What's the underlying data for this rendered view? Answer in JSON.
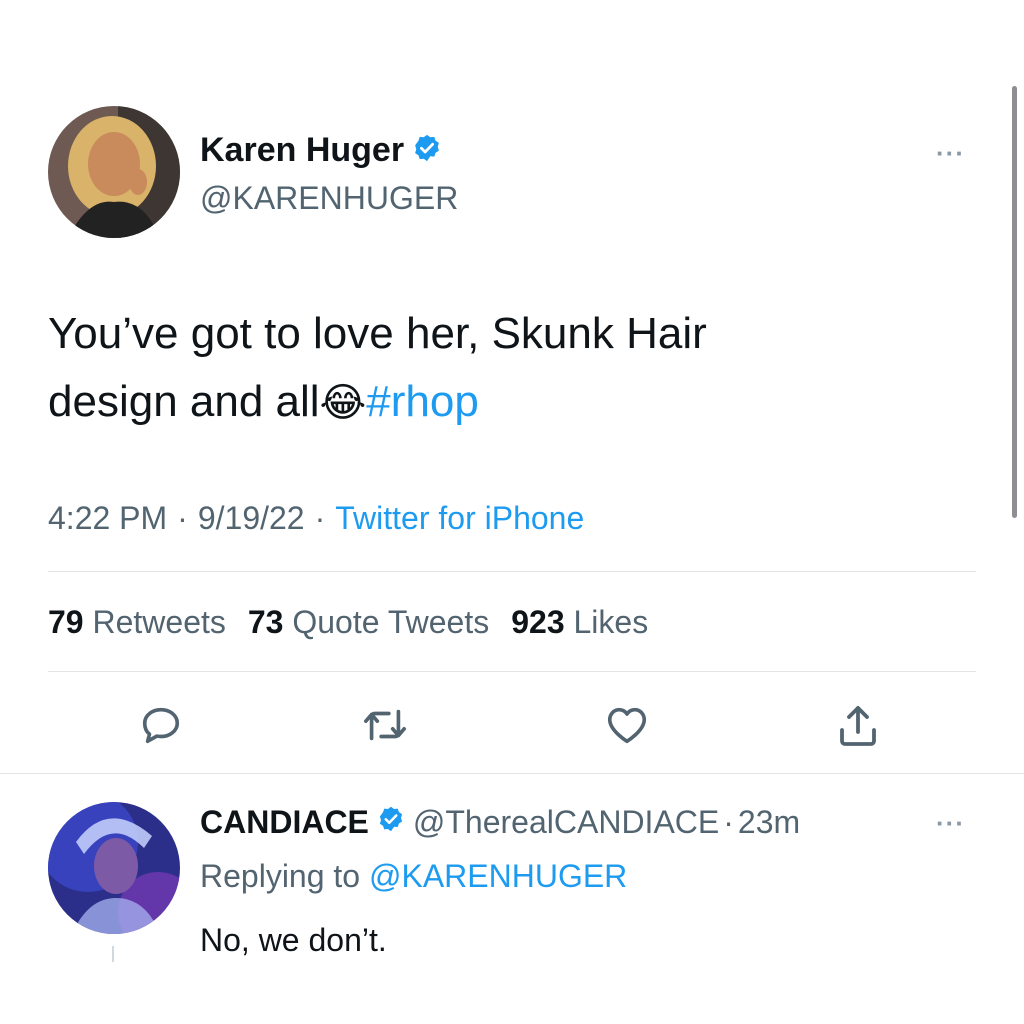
{
  "tweet": {
    "author_name": "Karen Huger",
    "author_handle": "@KARENHUGER",
    "text_line1": "You’ve got to love her, Skunk Hair",
    "text_line2": "design and all",
    "emoji": "😂",
    "hashtag": "#rhop",
    "time": "4:22 PM",
    "date": "9/19/22",
    "sep": "·",
    "source": "Twitter for iPhone",
    "more_label": "···"
  },
  "stats": {
    "retweets_count": "79",
    "retweets_label": "Retweets",
    "quotes_count": "73",
    "quotes_label": "Quote Tweets",
    "likes_count": "923",
    "likes_label": "Likes"
  },
  "actions": {
    "icons": [
      "reply-icon",
      "retweet-icon",
      "like-icon",
      "share-icon"
    ]
  },
  "reply": {
    "author_name": "CANDIACE",
    "author_handle": "@TherealCANDIACE",
    "sep": "·",
    "age": "23m",
    "replying_prefix": "Replying to",
    "replying_to": "@KARENHUGER",
    "text": "No, we don’t.",
    "more_label": "···"
  },
  "colors": {
    "accent": "#1d9bf0",
    "muted": "#536471",
    "text": "#0f1419"
  }
}
